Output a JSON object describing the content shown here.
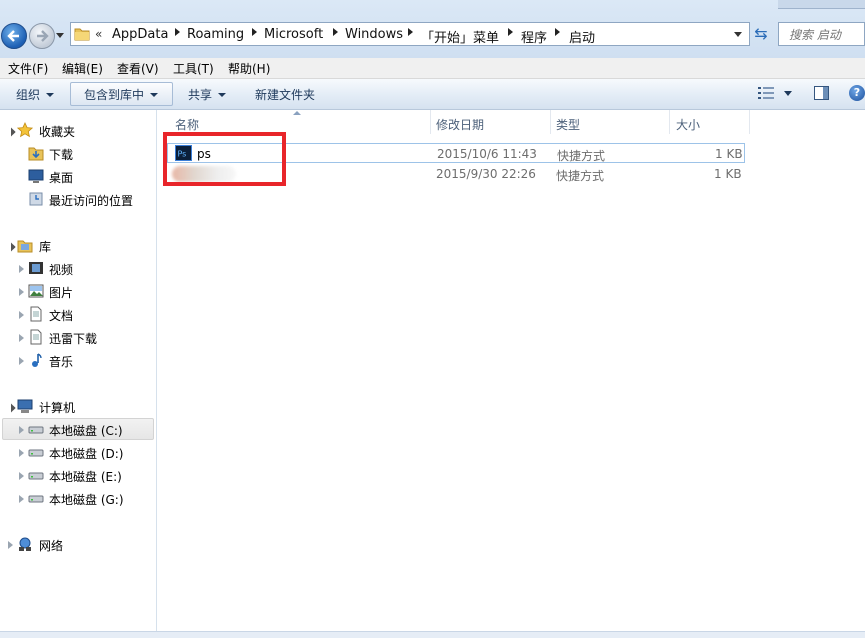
{
  "address_bar": {
    "overflow_chevron": "«",
    "crumbs": [
      "AppData",
      "Roaming",
      "Microsoft",
      "Windows",
      "「开始」菜单",
      "程序",
      "启动"
    ]
  },
  "search": {
    "placeholder": "搜索 启动"
  },
  "menu": [
    "文件(F)",
    "编辑(E)",
    "查看(V)",
    "工具(T)",
    "帮助(H)"
  ],
  "toolbar": {
    "organize": "组织",
    "include_in_library": "包含到库中",
    "share": "共享",
    "new_folder": "新建文件夹"
  },
  "nav": {
    "favorites": {
      "label": "收藏夹",
      "items": [
        "下载",
        "桌面",
        "最近访问的位置"
      ]
    },
    "libraries": {
      "label": "库",
      "items": [
        "视频",
        "图片",
        "文档",
        "迅雷下载",
        "音乐"
      ]
    },
    "computer": {
      "label": "计算机",
      "items": [
        "本地磁盘 (C:)",
        "本地磁盘 (D:)",
        "本地磁盘 (E:)",
        "本地磁盘 (G:)"
      ]
    },
    "network": {
      "label": "网络"
    }
  },
  "columns": [
    "名称",
    "修改日期",
    "类型",
    "大小"
  ],
  "files": [
    {
      "name": "ps",
      "modified": "2015/10/6 11:43",
      "type": "快捷方式",
      "size": "1 KB"
    },
    {
      "name": "",
      "modified": "2015/9/30 22:26",
      "type": "快捷方式",
      "size": "1 KB"
    }
  ],
  "colors": {
    "highlight_box": "#e8252a",
    "selection_border": "#9dc3e8",
    "accent": "#1d5fb4"
  },
  "icons": [
    "back-arrow-icon",
    "forward-arrow-icon",
    "folder-icon",
    "refresh-icon",
    "search-icon",
    "star-icon",
    "download-folder-icon",
    "desktop-icon",
    "recent-places-icon",
    "library-icon",
    "video-icon",
    "picture-icon",
    "document-icon",
    "music-icon",
    "computer-icon",
    "drive-icon",
    "network-icon",
    "photoshop-icon",
    "help-icon"
  ]
}
